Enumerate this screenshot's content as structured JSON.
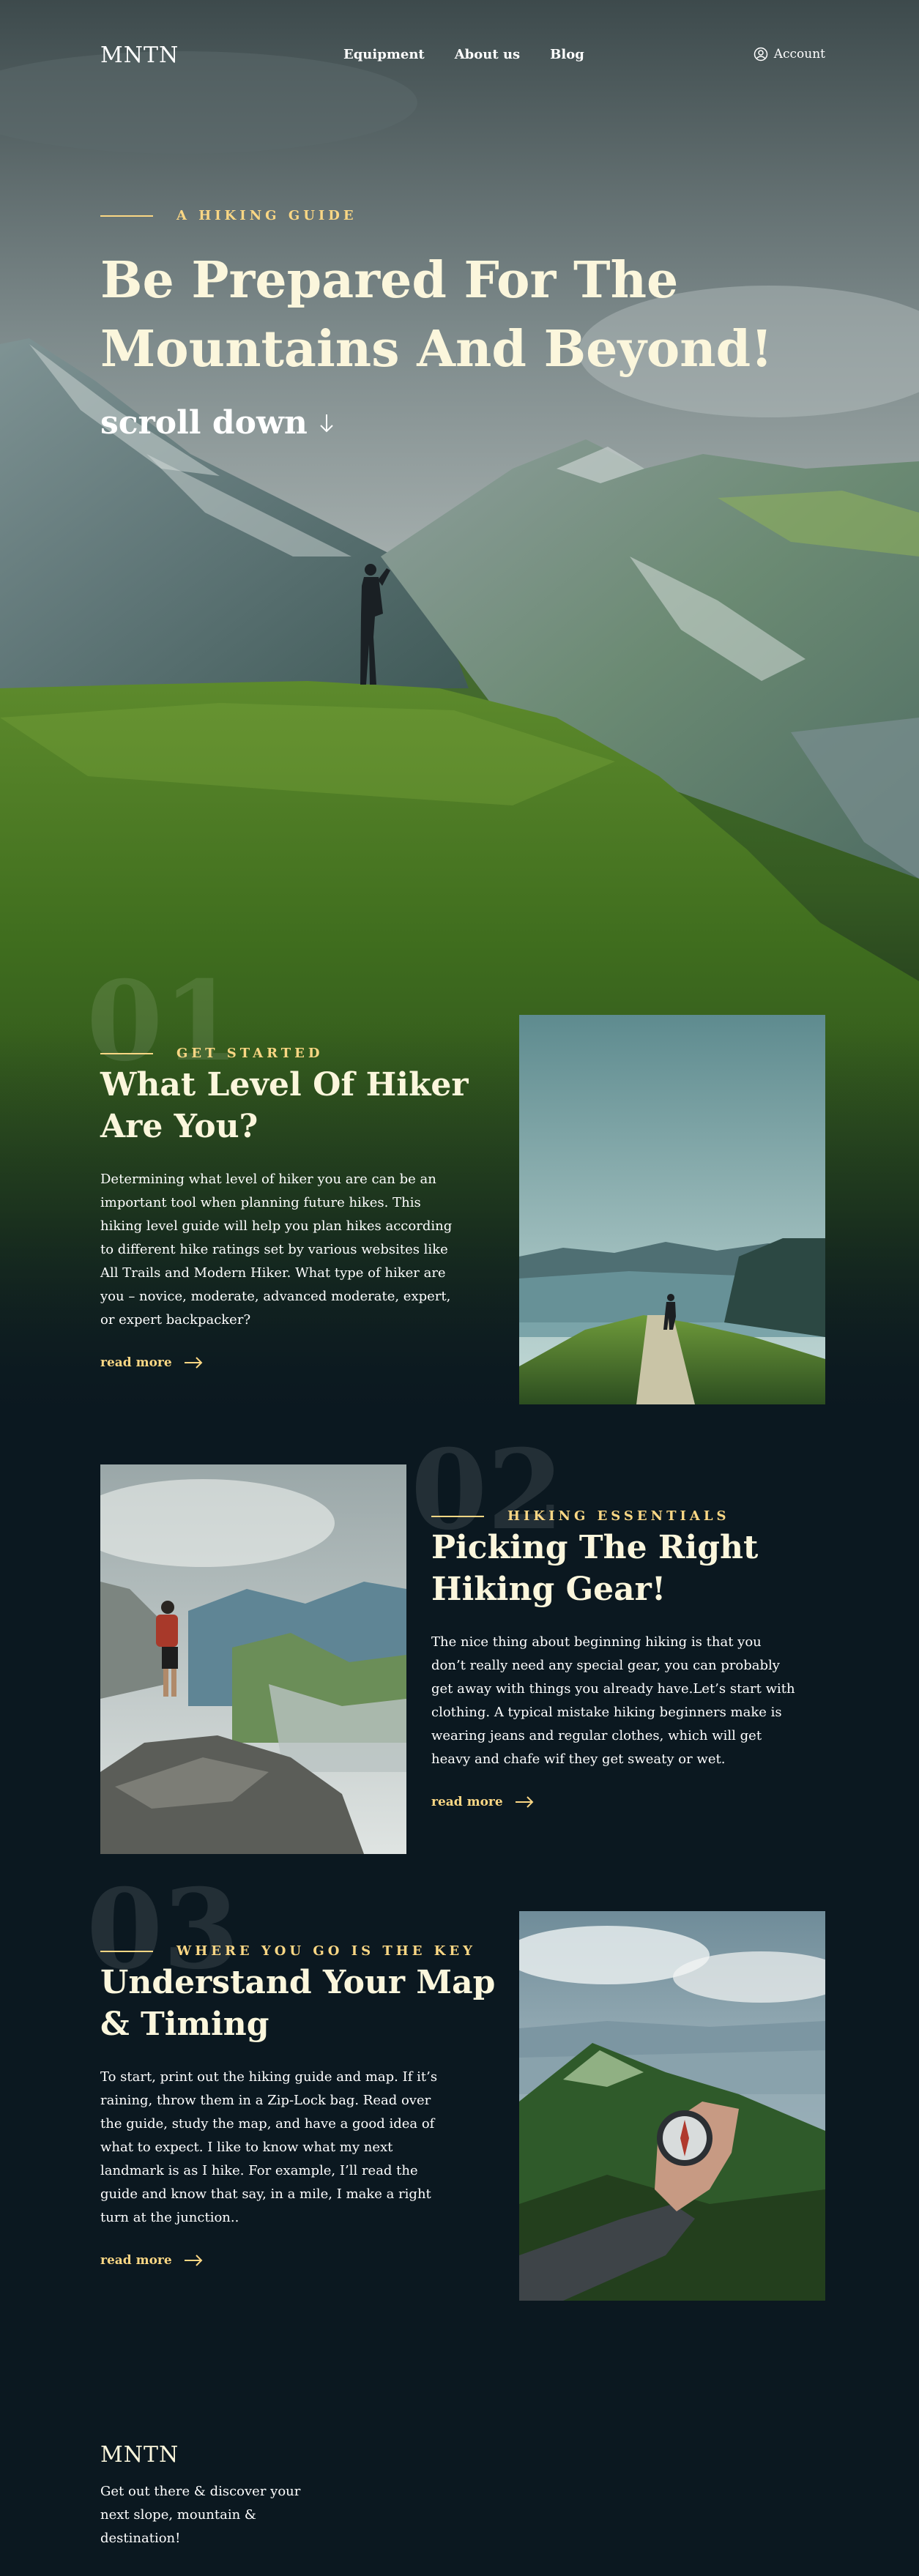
{
  "header": {
    "logo": "MNTN",
    "menu": [
      {
        "label": "Equipment"
      },
      {
        "label": "About us"
      },
      {
        "label": "Blog"
      }
    ],
    "account_label": "Account",
    "account_icon": "user-circle-icon"
  },
  "hero": {
    "eyebrow": "A HIKING GUIDE",
    "title": "Be Prepared For The Mountains And Beyond!",
    "scroll_label": "scroll down",
    "scroll_icon": "arrow-down-icon"
  },
  "sections": [
    {
      "number": "01",
      "eyebrow": "GET STARTED",
      "title": "What Level Of Hiker Are You?",
      "body": "Determining what level of hiker you are can be an important tool when planning future hikes. This hiking level guide will help you plan hikes according to different hike ratings set by various websites like All Trails and Modern Hiker. What type of hiker are you – novice, moderate, advanced moderate, expert, or expert backpacker?",
      "link": "read more",
      "link_icon": "arrow-right-icon"
    },
    {
      "number": "02",
      "eyebrow": "HIKING ESSENTIALS",
      "title": "Picking The Right Hiking Gear!",
      "body": "The nice thing about beginning hiking is that you don’t really need any special gear, you can probably get away with things you already have.Let’s start with clothing. A typical mistake hiking beginners make is wearing jeans and regular clothes, which will get heavy and chafe wif they get sweaty or wet.",
      "link": "read more",
      "link_icon": "arrow-right-icon"
    },
    {
      "number": "03",
      "eyebrow": "WHERE YOU GO IS THE KEY",
      "title": "Understand Your Map & Timing",
      "body": "To start, print out the hiking guide and map. If it’s raining, throw them in a Zip-Lock bag. Read over the guide, study the map, and have a good idea of what to expect. I like to know what my next landmark is as I hike. For example, I’ll read the guide and know that say, in a mile, I make a right turn at the junction..",
      "link": "read more",
      "link_icon": "arrow-right-icon"
    }
  ],
  "footer": {
    "logo": "MNTN",
    "tagline": "Get out there & discover your next slope, mountain & destination!"
  },
  "colors": {
    "accent": "#fbd784",
    "title": "#fbf6dc",
    "background": "#0b1820"
  }
}
